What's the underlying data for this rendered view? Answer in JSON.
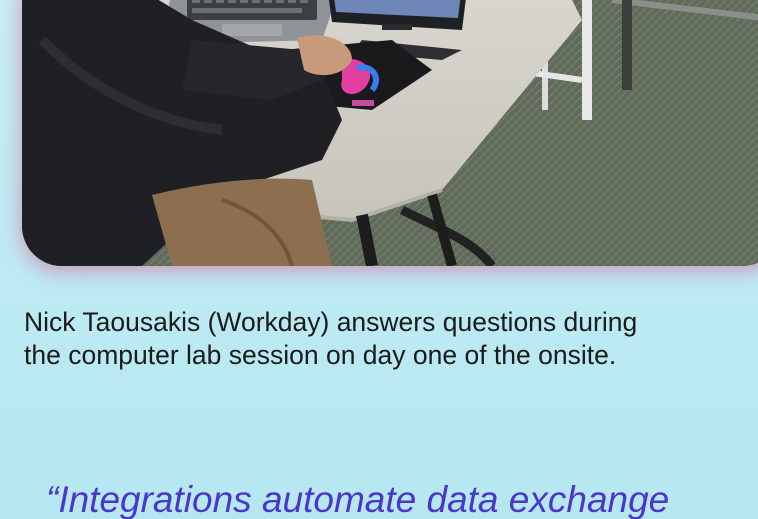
{
  "photo": {
    "subject": "lab-photo"
  },
  "caption": {
    "line1": "Nick Taousakis (Workday) answers questions during",
    "line2": "the computer lab session on day one of the onsite."
  },
  "quote": {
    "text": "“Integrations automate data exchange"
  },
  "colors": {
    "background": "#b8e9f2",
    "quote": "#4a36c8",
    "caption": "#1b1b1b",
    "glow": "#d890b8"
  }
}
